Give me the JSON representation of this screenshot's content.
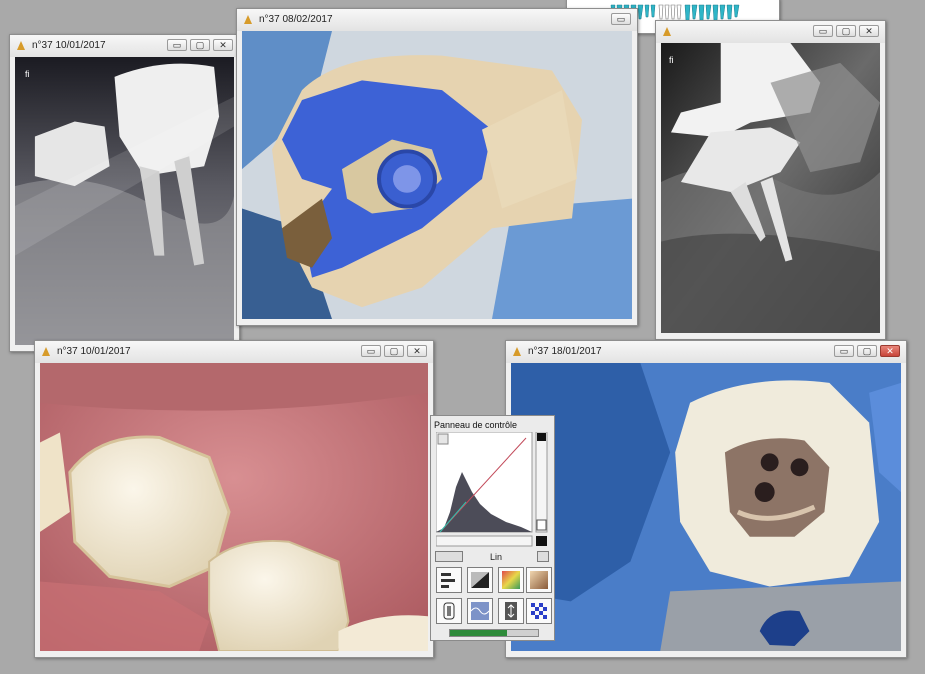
{
  "windows": {
    "xray_left": {
      "title": "n°37 10/01/2017",
      "marker": "fi"
    },
    "impression": {
      "title": "n°37 08/02/2017"
    },
    "xray_right": {
      "title": "",
      "marker": "fi"
    },
    "bottom_left": {
      "title": "n°37 10/01/2017"
    },
    "bottom_right": {
      "title": "n°37 18/01/2017"
    }
  },
  "window_controls": {
    "minimize": "▭",
    "maximize": "▢",
    "close": "✕"
  },
  "control_panel": {
    "title": "Panneau de contrôle",
    "curve_mode": "Lin"
  }
}
